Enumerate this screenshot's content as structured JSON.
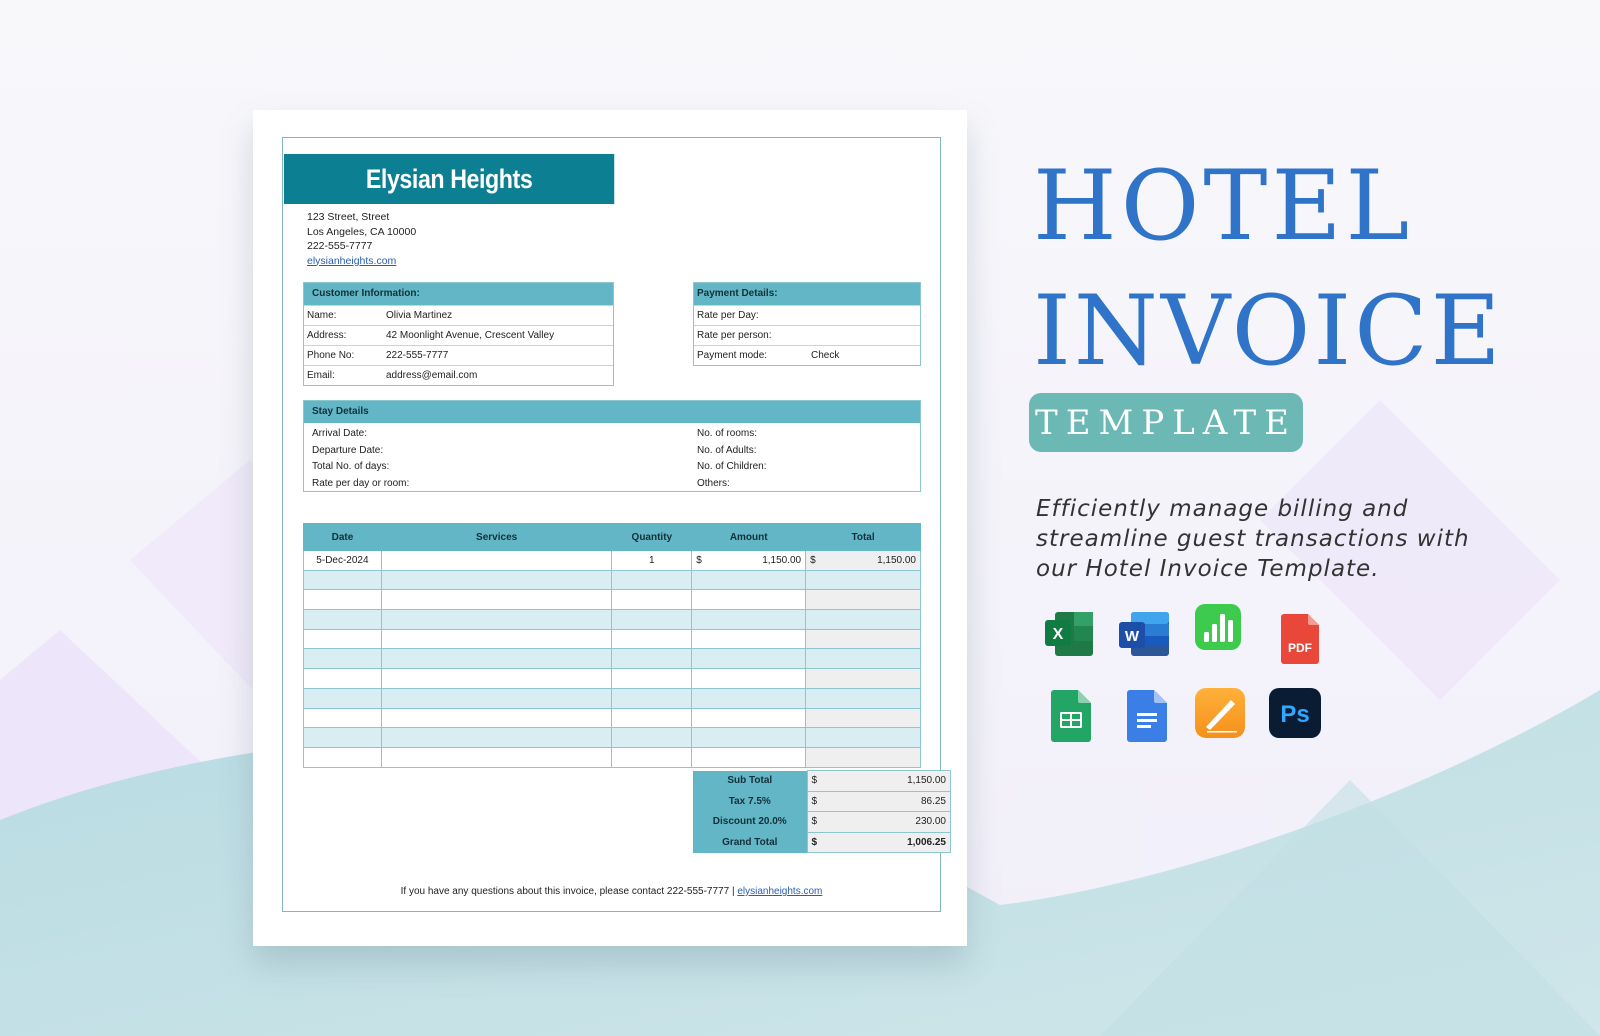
{
  "colors": {
    "brand_band": "#0d7f93",
    "table_header": "#63b6c6",
    "stripe": "#d9eef2",
    "title_blue": "#2f74c8",
    "pill_teal": "#6bb8b5"
  },
  "invoice": {
    "brand_name": "Elysian Heights",
    "address": {
      "line1": "123 Street, Street",
      "line2": "Los Angeles, CA 10000",
      "phone": "222-555-7777",
      "website": "elysianheights.com"
    },
    "customer": {
      "heading": "Customer Information:",
      "rows": [
        {
          "label": "Name:",
          "value": "Olivia Martinez"
        },
        {
          "label": "Address:",
          "value": "42 Moonlight Avenue, Crescent Valley"
        },
        {
          "label": "Phone No:",
          "value": "222-555-7777"
        },
        {
          "label": "Email:",
          "value": "address@email.com"
        }
      ]
    },
    "payment": {
      "heading": "Payment  Details:",
      "rows": [
        {
          "label": "Rate per Day:",
          "value": ""
        },
        {
          "label": "Rate per person:",
          "value": ""
        },
        {
          "label": "Payment mode:",
          "value": "Check"
        }
      ]
    },
    "stay": {
      "heading": "Stay Details",
      "left": [
        "Arrival Date:",
        "Departure Date:",
        "Total No. of days:",
        "Rate per day or room:"
      ],
      "right": [
        "No. of rooms:",
        "No. of Adults:",
        "No. of Children:",
        "Others:"
      ]
    },
    "items": {
      "columns": [
        "Date",
        "Services",
        "Quantity",
        "Amount",
        "Total"
      ],
      "currency": "$",
      "rows": [
        {
          "date": "5-Dec-2024",
          "service": "",
          "qty": "1",
          "amount": "1,150.00",
          "total": "1,150.00"
        },
        {
          "date": "",
          "service": "",
          "qty": "",
          "amount": "",
          "total": ""
        },
        {
          "date": "",
          "service": "",
          "qty": "",
          "amount": "",
          "total": ""
        },
        {
          "date": "",
          "service": "",
          "qty": "",
          "amount": "",
          "total": ""
        },
        {
          "date": "",
          "service": "",
          "qty": "",
          "amount": "",
          "total": ""
        },
        {
          "date": "",
          "service": "",
          "qty": "",
          "amount": "",
          "total": ""
        },
        {
          "date": "",
          "service": "",
          "qty": "",
          "amount": "",
          "total": ""
        },
        {
          "date": "",
          "service": "",
          "qty": "",
          "amount": "",
          "total": ""
        },
        {
          "date": "",
          "service": "",
          "qty": "",
          "amount": "",
          "total": ""
        },
        {
          "date": "",
          "service": "",
          "qty": "",
          "amount": "",
          "total": ""
        },
        {
          "date": "",
          "service": "",
          "qty": "",
          "amount": "",
          "total": ""
        }
      ]
    },
    "totals": [
      {
        "label": "Sub Total",
        "currency": "$",
        "value": "1,150.00"
      },
      {
        "label": "Tax  7.5%",
        "currency": "$",
        "value": "86.25"
      },
      {
        "label": "Discount   20.0%",
        "currency": "$",
        "value": "230.00"
      },
      {
        "label": "Grand Total",
        "currency": "$",
        "value": "1,006.25"
      }
    ],
    "footer": {
      "text": "If you have any questions about this invoice, please contact 222-555-7777 | ",
      "link": "elysianheights.com"
    }
  },
  "promo": {
    "title_line1": "HOTEL",
    "title_line2": "INVOICE",
    "badge": "TEMPLATE",
    "tagline": "Efficiently manage billing and streamline guest transactions with our Hotel Invoice Template.",
    "apps": [
      {
        "name": "excel-icon",
        "letter": "X"
      },
      {
        "name": "word-icon",
        "letter": "W"
      },
      {
        "name": "numbers-icon",
        "letter": ""
      },
      {
        "name": "pdf-icon",
        "letter": "PDF"
      },
      {
        "name": "google-sheets-icon",
        "letter": ""
      },
      {
        "name": "google-docs-icon",
        "letter": ""
      },
      {
        "name": "pages-icon",
        "letter": ""
      },
      {
        "name": "photoshop-icon",
        "letter": "Ps"
      }
    ]
  }
}
